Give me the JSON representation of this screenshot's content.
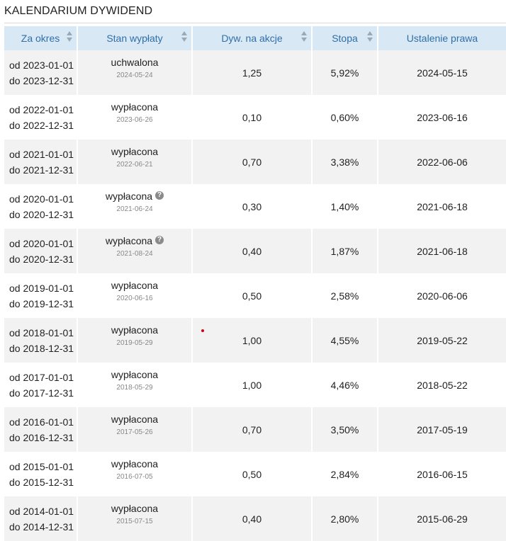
{
  "page": {
    "title": "KALENDARIUM DYWIDEND"
  },
  "table": {
    "headers": {
      "period": "Za okres",
      "status": "Stan wypłaty",
      "dividend": "Dyw. na akcje",
      "yield": "Stopa",
      "record_date": "Ustalenie prawa"
    },
    "rows": [
      {
        "from": "od 2023-01-01",
        "to": "do 2023-12-31",
        "status": "uchwalona",
        "status_date": "2024-05-24",
        "help": false,
        "dividend": "1,25",
        "yield": "5,92%",
        "record_date": "2024-05-15"
      },
      {
        "from": "od 2022-01-01",
        "to": "do 2022-12-31",
        "status": "wypłacona",
        "status_date": "2023-06-26",
        "help": false,
        "dividend": "0,10",
        "yield": "0,60%",
        "record_date": "2023-06-16"
      },
      {
        "from": "od 2021-01-01",
        "to": "do 2021-12-31",
        "status": "wypłacona",
        "status_date": "2022-06-21",
        "help": false,
        "dividend": "0,70",
        "yield": "3,38%",
        "record_date": "2022-06-06"
      },
      {
        "from": "od 2020-01-01",
        "to": "do 2020-12-31",
        "status": "wypłacona",
        "status_date": "2021-06-24",
        "help": true,
        "dividend": "0,30",
        "yield": "1,40%",
        "record_date": "2021-06-18"
      },
      {
        "from": "od 2020-01-01",
        "to": "do 2020-12-31",
        "status": "wypłacona",
        "status_date": "2021-08-24",
        "help": true,
        "dividend": "0,40",
        "yield": "1,87%",
        "record_date": "2021-06-18"
      },
      {
        "from": "od 2019-01-01",
        "to": "do 2019-12-31",
        "status": "wypłacona",
        "status_date": "2020-06-16",
        "help": false,
        "dividend": "0,50",
        "yield": "2,58%",
        "record_date": "2020-06-06"
      },
      {
        "from": "od 2018-01-01",
        "to": "do 2018-12-31",
        "status": "wypłacona",
        "status_date": "2019-05-29",
        "help": false,
        "dividend": "1,00",
        "yield": "4,55%",
        "record_date": "2019-05-22"
      },
      {
        "from": "od 2017-01-01",
        "to": "do 2017-12-31",
        "status": "wypłacona",
        "status_date": "2018-05-29",
        "help": false,
        "dividend": "1,00",
        "yield": "4,46%",
        "record_date": "2018-05-22"
      },
      {
        "from": "od 2016-01-01",
        "to": "do 2016-12-31",
        "status": "wypłacona",
        "status_date": "2017-05-26",
        "help": false,
        "dividend": "0,70",
        "yield": "3,50%",
        "record_date": "2017-05-19"
      },
      {
        "from": "od 2015-01-01",
        "to": "do 2015-12-31",
        "status": "wypłacona",
        "status_date": "2016-07-05",
        "help": false,
        "dividend": "0,50",
        "yield": "2,84%",
        "record_date": "2016-06-15"
      },
      {
        "from": "od 2014-01-01",
        "to": "do 2014-12-31",
        "status": "wypłacona",
        "status_date": "2015-07-15",
        "help": false,
        "dividend": "0,40",
        "yield": "2,80%",
        "record_date": "2015-06-29"
      }
    ]
  },
  "icons": {
    "sort": "sort-arrows-icon",
    "help": "question-circle-icon",
    "help_glyph": "?"
  },
  "colors": {
    "header_bg": "#d9e8f5",
    "header_text": "#2f6fa8",
    "row_alt": "#f2f2f2",
    "help_icon": "#8a8a8a"
  }
}
